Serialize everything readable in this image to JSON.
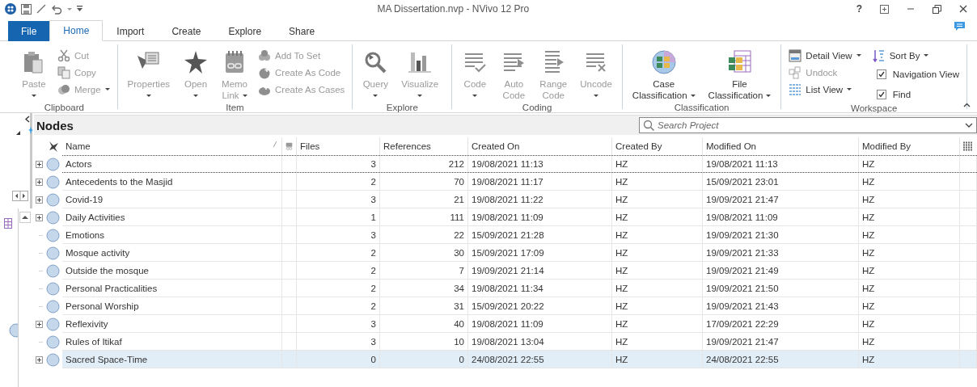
{
  "window": {
    "title": "MA Dissertation.nvp - NVivo 12 Pro",
    "help": "?"
  },
  "tabs": [
    {
      "label": "File",
      "kind": "file",
      "selected": false
    },
    {
      "label": "Home",
      "kind": "normal",
      "selected": true
    },
    {
      "label": "Import",
      "kind": "normal",
      "selected": false
    },
    {
      "label": "Create",
      "kind": "normal",
      "selected": false
    },
    {
      "label": "Explore",
      "kind": "normal",
      "selected": false
    },
    {
      "label": "Share",
      "kind": "normal",
      "selected": false
    }
  ],
  "ribbon": {
    "groups": [
      {
        "label": "Clipboard",
        "items": [
          {
            "kind": "large",
            "lines": [
              "Paste"
            ],
            "dropdown": true,
            "disabled": true
          },
          {
            "kind": "small",
            "label": "Cut",
            "dropdown": false,
            "disabled": true
          },
          {
            "kind": "small",
            "label": "Copy",
            "dropdown": false,
            "disabled": true
          },
          {
            "kind": "small",
            "label": "Merge",
            "dropdown": true,
            "disabled": true
          }
        ]
      },
      {
        "label": "Item",
        "items": [
          {
            "kind": "large",
            "lines": [
              "Properties"
            ],
            "dropdown": true,
            "disabled": true
          },
          {
            "kind": "large",
            "lines": [
              "Open"
            ],
            "dropdown": true,
            "disabled": true
          },
          {
            "kind": "large",
            "lines": [
              "Memo",
              "Link"
            ],
            "dropdown": true,
            "disabled": true
          },
          {
            "kind": "small",
            "label": "Add To Set",
            "dropdown": false,
            "disabled": true
          },
          {
            "kind": "small",
            "label": "Create As Code",
            "dropdown": false,
            "disabled": true
          },
          {
            "kind": "small",
            "label": "Create As Cases",
            "dropdown": false,
            "disabled": true
          }
        ]
      },
      {
        "label": "Explore",
        "items": [
          {
            "kind": "large",
            "lines": [
              "Query"
            ],
            "dropdown": true,
            "disabled": true
          },
          {
            "kind": "large",
            "lines": [
              "Visualize"
            ],
            "dropdown": true,
            "disabled": true
          }
        ]
      },
      {
        "label": "Coding",
        "items": [
          {
            "kind": "large",
            "lines": [
              "Code"
            ],
            "dropdown": true,
            "disabled": true
          },
          {
            "kind": "large",
            "lines": [
              "Auto",
              "Code"
            ],
            "dropdown": false,
            "disabled": true
          },
          {
            "kind": "large",
            "lines": [
              "Range",
              "Code"
            ],
            "dropdown": false,
            "disabled": true
          },
          {
            "kind": "large",
            "lines": [
              "Uncode"
            ],
            "dropdown": true,
            "disabled": true
          }
        ]
      },
      {
        "label": "Classification",
        "items": [
          {
            "kind": "large",
            "lines": [
              "Case",
              "Classification"
            ],
            "dropdown": true,
            "disabled": false
          },
          {
            "kind": "large",
            "lines": [
              "File",
              "Classification"
            ],
            "dropdown": true,
            "disabled": false
          }
        ]
      },
      {
        "label": "Workspace",
        "items": [
          {
            "kind": "small",
            "label": "Detail View",
            "dropdown": true,
            "disabled": false
          },
          {
            "kind": "small",
            "label": "Undock",
            "dropdown": false,
            "disabled": true
          },
          {
            "kind": "small",
            "label": "List View",
            "dropdown": true,
            "disabled": false
          },
          {
            "kind": "small",
            "label": "Sort By",
            "dropdown": true,
            "disabled": false
          },
          {
            "kind": "check",
            "label": "Navigation View",
            "checked": true
          },
          {
            "kind": "check",
            "label": "Find",
            "checked": true
          }
        ]
      }
    ]
  },
  "nodes": {
    "title": "Nodes",
    "search": {
      "placeholder": "Search Project"
    },
    "columns": [
      "Name",
      "Files",
      "References",
      "Created On",
      "Created By",
      "Modified On",
      "Modified By"
    ],
    "rows": [
      {
        "name": "Actors",
        "expandable": true,
        "selected": false,
        "focused": true,
        "files": "3",
        "references": "212",
        "created_on": "19/08/2021 11:13",
        "created_by": "HZ",
        "modified_on": "19/08/2021 11:13",
        "modified_by": "HZ"
      },
      {
        "name": "Antecedents to the Masjid",
        "expandable": true,
        "selected": false,
        "focused": false,
        "files": "2",
        "references": "70",
        "created_on": "19/08/2021 11:17",
        "created_by": "HZ",
        "modified_on": "15/09/2021 23:01",
        "modified_by": "HZ"
      },
      {
        "name": "Covid-19",
        "expandable": true,
        "selected": false,
        "focused": false,
        "files": "3",
        "references": "21",
        "created_on": "19/08/2021 11:22",
        "created_by": "HZ",
        "modified_on": "19/09/2021 21:47",
        "modified_by": "HZ"
      },
      {
        "name": "Daily Activities",
        "expandable": true,
        "selected": false,
        "focused": false,
        "files": "1",
        "references": "111",
        "created_on": "19/08/2021 11:09",
        "created_by": "HZ",
        "modified_on": "19/08/2021 11:09",
        "modified_by": "HZ"
      },
      {
        "name": "Emotions",
        "expandable": false,
        "selected": false,
        "focused": false,
        "files": "3",
        "references": "22",
        "created_on": "15/09/2021 21:28",
        "created_by": "HZ",
        "modified_on": "19/09/2021 21:30",
        "modified_by": "HZ"
      },
      {
        "name": "Mosque activity",
        "expandable": false,
        "selected": false,
        "focused": false,
        "files": "2",
        "references": "30",
        "created_on": "15/09/2021 17:09",
        "created_by": "HZ",
        "modified_on": "19/09/2021 21:33",
        "modified_by": "HZ"
      },
      {
        "name": "Outside the mosque",
        "expandable": false,
        "selected": false,
        "focused": false,
        "files": "2",
        "references": "7",
        "created_on": "19/09/2021 21:14",
        "created_by": "HZ",
        "modified_on": "19/09/2021 21:49",
        "modified_by": "HZ"
      },
      {
        "name": "Personal Practicalities",
        "expandable": false,
        "selected": false,
        "focused": false,
        "files": "2",
        "references": "34",
        "created_on": "19/08/2021 11:34",
        "created_by": "HZ",
        "modified_on": "19/09/2021 21:50",
        "modified_by": "HZ"
      },
      {
        "name": "Personal Worship",
        "expandable": false,
        "selected": false,
        "focused": false,
        "files": "2",
        "references": "31",
        "created_on": "15/09/2021 20:22",
        "created_by": "HZ",
        "modified_on": "19/09/2021 21:43",
        "modified_by": "HZ"
      },
      {
        "name": "Reflexivity",
        "expandable": true,
        "selected": false,
        "focused": false,
        "files": "3",
        "references": "40",
        "created_on": "19/08/2021 11:09",
        "created_by": "HZ",
        "modified_on": "17/09/2021 22:29",
        "modified_by": "HZ"
      },
      {
        "name": "Rules of Itikaf",
        "expandable": false,
        "selected": false,
        "focused": false,
        "files": "3",
        "references": "10",
        "created_on": "19/08/2021 13:04",
        "created_by": "HZ",
        "modified_on": "19/09/2021 21:47",
        "modified_by": "HZ"
      },
      {
        "name": "Sacred Space-Time",
        "expandable": true,
        "selected": true,
        "focused": false,
        "files": "0",
        "references": "0",
        "created_on": "24/08/2021 22:55",
        "created_by": "HZ",
        "modified_on": "24/08/2021 22:55",
        "modified_by": "HZ"
      }
    ]
  }
}
